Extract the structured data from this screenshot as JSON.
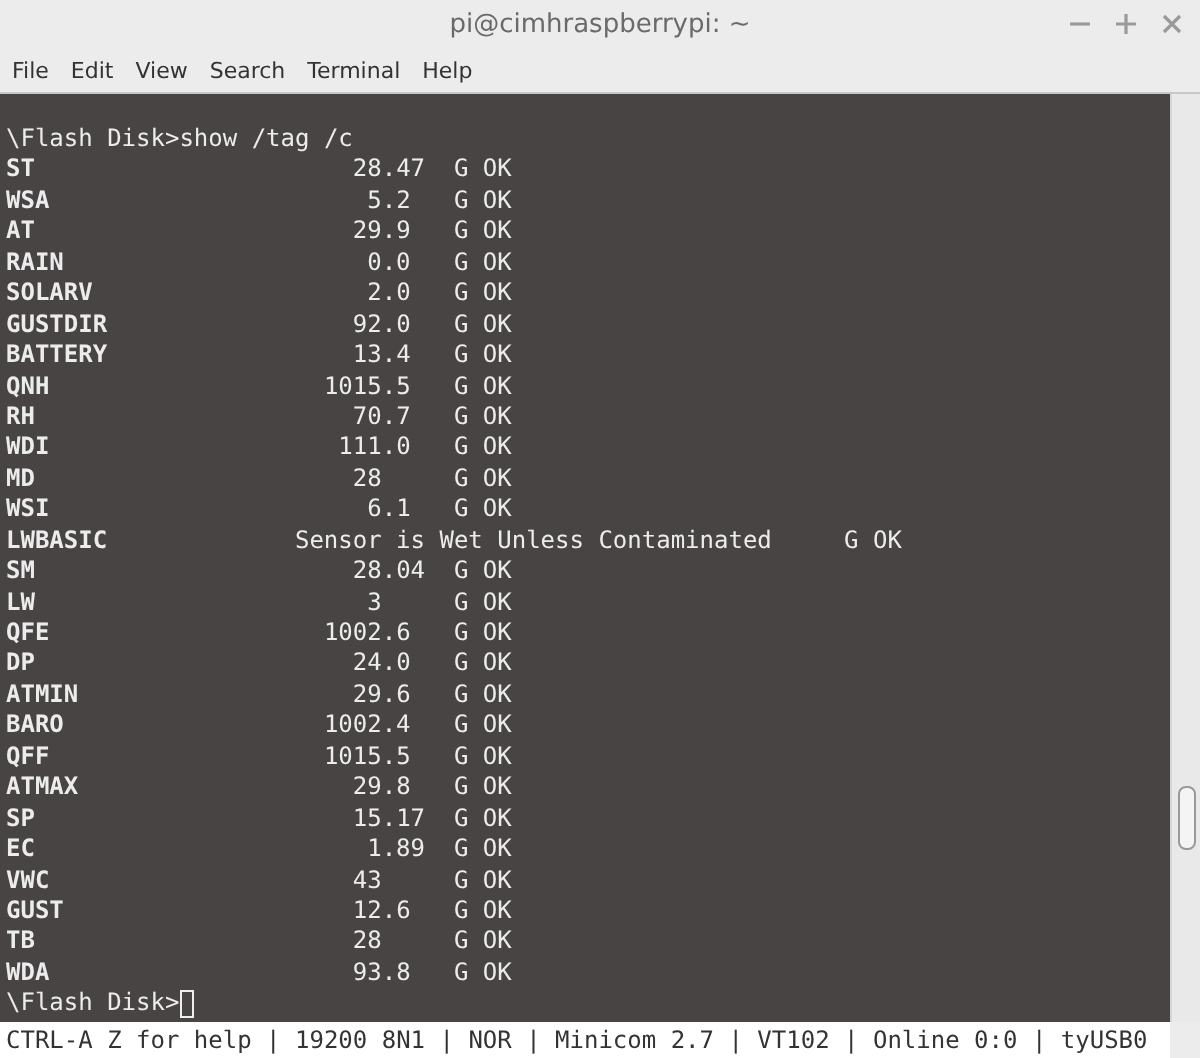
{
  "window": {
    "title": "pi@cimhraspberrypi: ~"
  },
  "menu": [
    "File",
    "Edit",
    "View",
    "Search",
    "Terminal",
    "Help"
  ],
  "terminal": {
    "command_line": "\\Flash Disk>show /tag /c",
    "rows": [
      {
        "kind": "number",
        "name": "ST",
        "value": "28.47",
        "status": "G OK"
      },
      {
        "kind": "number",
        "name": "WSA",
        "value": "5.2",
        "status": "G OK"
      },
      {
        "kind": "number",
        "name": "AT",
        "value": "29.9",
        "status": "G OK"
      },
      {
        "kind": "number",
        "name": "RAIN",
        "value": "0.0",
        "status": "G OK"
      },
      {
        "kind": "number",
        "name": "SOLARV",
        "value": "2.0",
        "status": "G OK"
      },
      {
        "kind": "number",
        "name": "GUSTDIR",
        "value": "92.0",
        "status": "G OK"
      },
      {
        "kind": "number",
        "name": "BATTERY",
        "value": "13.4",
        "status": "G OK"
      },
      {
        "kind": "number",
        "name": "QNH",
        "value": "1015.5",
        "status": "G OK"
      },
      {
        "kind": "number",
        "name": "RH",
        "value": "70.7",
        "status": "G OK"
      },
      {
        "kind": "number",
        "name": "WDI",
        "value": "111.0",
        "status": "G OK"
      },
      {
        "kind": "number",
        "name": "MD",
        "value": "28",
        "status": "G OK"
      },
      {
        "kind": "number",
        "name": "WSI",
        "value": "6.1",
        "status": "G OK"
      },
      {
        "kind": "text",
        "name": "LWBASIC",
        "value": "Sensor is Wet Unless Contaminated",
        "status": "G OK"
      },
      {
        "kind": "number",
        "name": "SM",
        "value": "28.04",
        "status": "G OK"
      },
      {
        "kind": "number",
        "name": "LW",
        "value": "3",
        "status": "G OK"
      },
      {
        "kind": "number",
        "name": "QFE",
        "value": "1002.6",
        "status": "G OK"
      },
      {
        "kind": "number",
        "name": "DP",
        "value": "24.0",
        "status": "G OK"
      },
      {
        "kind": "number",
        "name": "ATMIN",
        "value": "29.6",
        "status": "G OK"
      },
      {
        "kind": "number",
        "name": "BARO",
        "value": "1002.4",
        "status": "G OK"
      },
      {
        "kind": "number",
        "name": "QFF",
        "value": "1015.5",
        "status": "G OK"
      },
      {
        "kind": "number",
        "name": "ATMAX",
        "value": "29.8",
        "status": "G OK"
      },
      {
        "kind": "number",
        "name": "SP",
        "value": "15.17",
        "status": "G OK"
      },
      {
        "kind": "number",
        "name": "EC",
        "value": "1.89",
        "status": "G OK"
      },
      {
        "kind": "number",
        "name": "VWC",
        "value": "43",
        "status": "G OK"
      },
      {
        "kind": "number",
        "name": "GUST",
        "value": "12.6",
        "status": "G OK"
      },
      {
        "kind": "number",
        "name": "TB",
        "value": "28",
        "status": "G OK"
      },
      {
        "kind": "number",
        "name": "WDA",
        "value": "93.8",
        "status": "G OK"
      }
    ],
    "prompt": "\\Flash Disk>"
  },
  "status_line": "CTRL-A Z for help | 19200 8N1 | NOR | Minicom 2.7 | VT102 | Online 0:0 | tyUSB0"
}
